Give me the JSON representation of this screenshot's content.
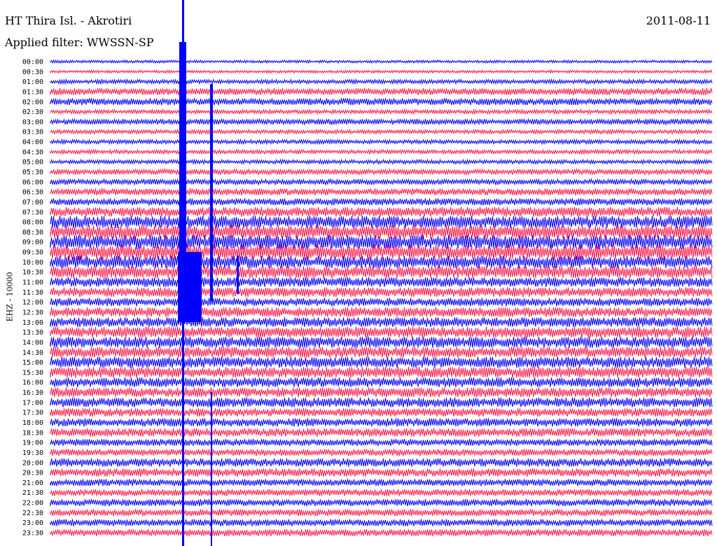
{
  "header": {
    "station": "HT Thira Isl. - Akrotiri",
    "filter": "Applied filter: WWSSN-SP",
    "date": "2011-08-11"
  },
  "colors": {
    "trace_a": "#0000ff",
    "trace_b": "#ff1a4a"
  },
  "chart_data": {
    "type": "line",
    "title": "HT Thira Isl. - Akrotiri",
    "subtitle": "Applied filter: WWSSN-SP",
    "ylabel": "EHZ - 10000",
    "rows": [
      "00:00",
      "00:30",
      "01:00",
      "01:30",
      "02:00",
      "02:30",
      "03:00",
      "03:30",
      "04:00",
      "04:30",
      "05:00",
      "05:30",
      "06:00",
      "06:30",
      "07:00",
      "07:30",
      "08:00",
      "08:30",
      "09:00",
      "09:30",
      "10:00",
      "10:30",
      "11:00",
      "11:30",
      "12:00",
      "12:30",
      "13:00",
      "13:30",
      "14:00",
      "14:30",
      "15:00",
      "15:30",
      "16:00",
      "16:30",
      "17:00",
      "17:30",
      "18:00",
      "18:30",
      "19:00",
      "19:30",
      "20:00",
      "20:30",
      "21:00",
      "21:30",
      "22:00",
      "22:30",
      "23:00",
      "23:30"
    ],
    "noise_level": [
      2,
      2,
      3,
      5,
      5,
      3,
      4,
      3,
      3,
      3,
      3,
      4,
      4,
      5,
      5,
      7,
      9,
      10,
      10,
      11,
      9,
      9,
      7,
      7,
      6,
      7,
      7,
      8,
      8,
      8,
      8,
      8,
      7,
      7,
      7,
      6,
      6,
      6,
      5,
      5,
      6,
      6,
      5,
      5,
      5,
      5,
      5,
      5
    ]
  }
}
